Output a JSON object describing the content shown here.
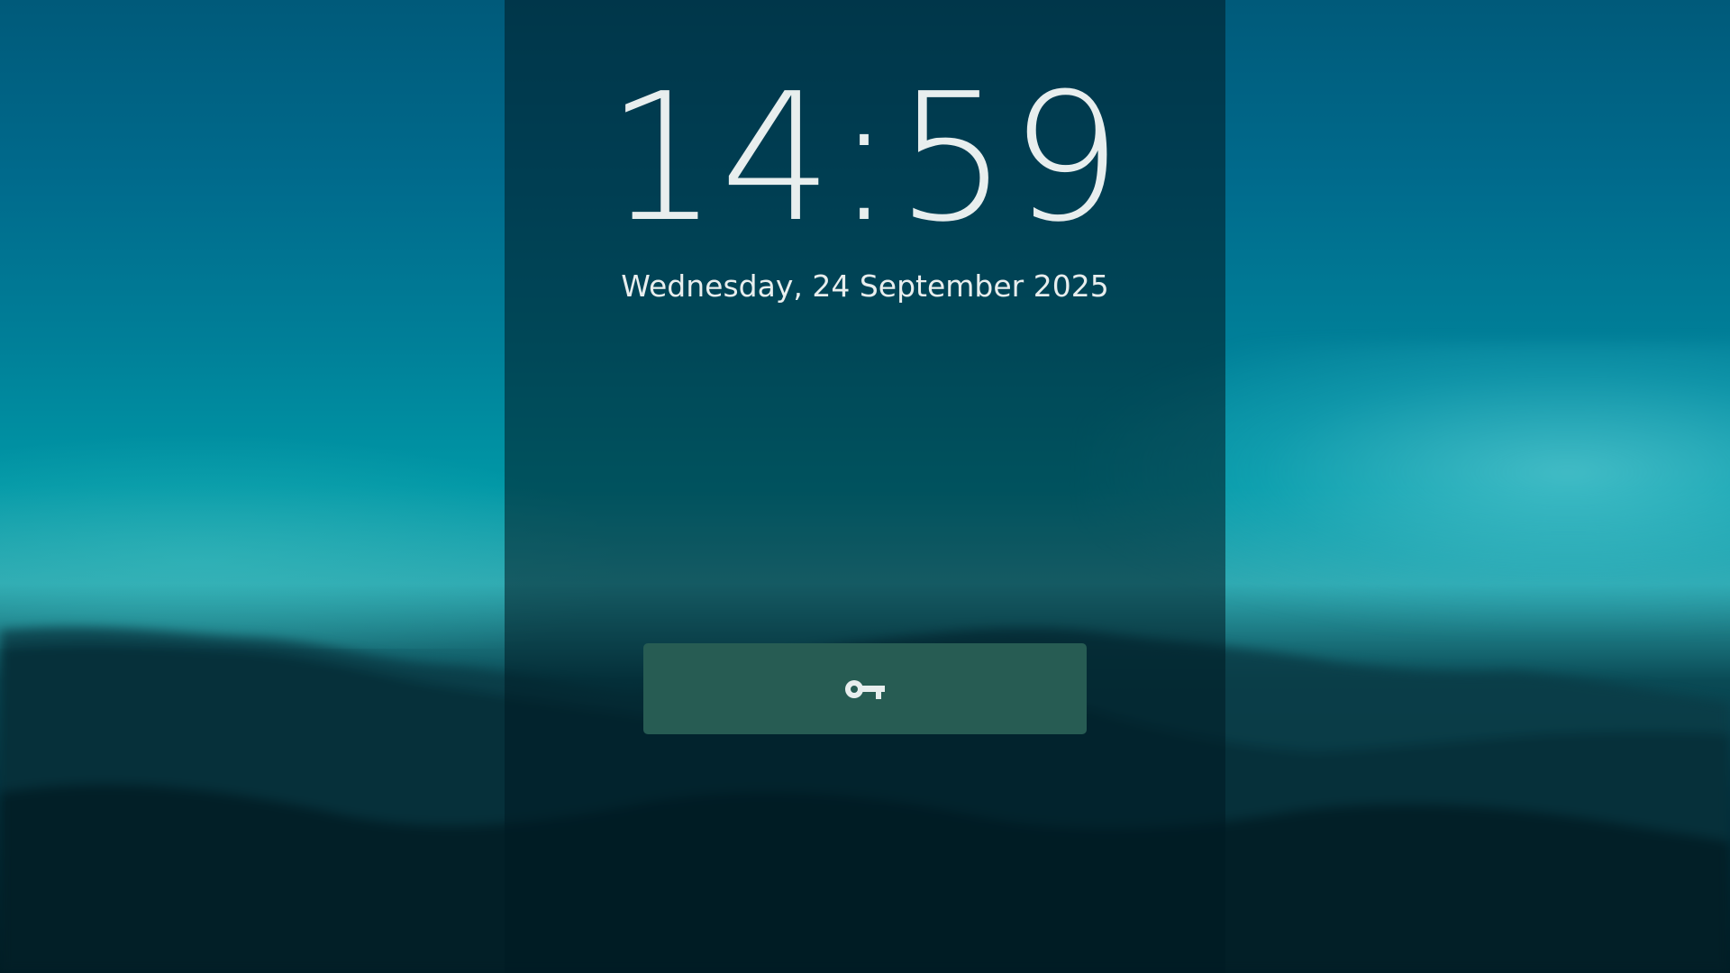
{
  "lockscreen": {
    "time": "14:59",
    "date": "Wednesday, 24 September 2025",
    "unlock_icon": "key-icon"
  },
  "colors": {
    "overlay": "#00191f",
    "button": "#275c53",
    "text": "#e8eeee"
  }
}
